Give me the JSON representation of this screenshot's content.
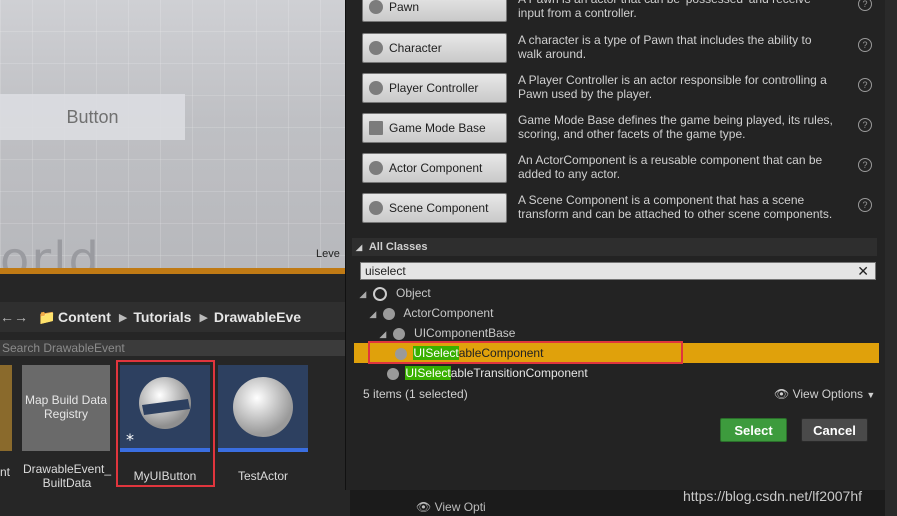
{
  "viewport": {
    "widget_text": "Button",
    "watermark_text": "orld",
    "level_label": "Leve"
  },
  "content_browser": {
    "path": [
      "Content",
      "Tutorials",
      "DrawableEve"
    ],
    "search_placeholder": "Search DrawableEvent",
    "assets": [
      {
        "label": "nt"
      },
      {
        "label": "Map Build Data Registry"
      },
      {
        "label": "DrawableEvent_ BuiltData"
      },
      {
        "label": "MyUIButton"
      },
      {
        "label": "TestActor"
      }
    ],
    "view_options": "View Opti"
  },
  "dialog": {
    "common_classes": [
      {
        "name": "Pawn",
        "icon": "pawn-icon",
        "description": "A Pawn is an actor that can be 'possessed' and receive input from a controller."
      },
      {
        "name": "Character",
        "icon": "character-icon",
        "description": "A character is a type of Pawn that includes the ability to walk around."
      },
      {
        "name": "Player Controller",
        "icon": "player-controller-icon",
        "description": "A Player Controller is an actor responsible for controlling a Pawn used by the player."
      },
      {
        "name": "Game Mode Base",
        "icon": "game-mode-icon",
        "description": "Game Mode Base defines the game being played, its rules, scoring, and other facets of the game type."
      },
      {
        "name": "Actor Component",
        "icon": "actor-component-icon",
        "description": "An ActorComponent is a reusable component that can be added to any actor."
      },
      {
        "name": "Scene Component",
        "icon": "scene-component-icon",
        "description": "A Scene Component is a component that has a scene transform and can be attached to other scene components."
      }
    ],
    "all_classes_label": "All Classes",
    "filter_value": "uiselect",
    "tree": [
      {
        "label": "Object",
        "indent": 0
      },
      {
        "label": "ActorComponent",
        "indent": 1
      },
      {
        "label": "UIComponentBase",
        "indent": 2
      },
      {
        "label_hl": "UISelect",
        "label_rest": "ableComponent",
        "indent": 3,
        "selected": true
      },
      {
        "label_hl": "UISelect",
        "label_rest": "ableTransitionComponent",
        "indent": 3
      }
    ],
    "status": "5 items (1 selected)",
    "view_options": "View Options",
    "select_label": "Select",
    "cancel_label": "Cancel"
  },
  "watermark": "https://blog.csdn.net/lf2007hf",
  "colors": {
    "select_button": "#3d9b3d",
    "selected_row": "#e0a10b",
    "search_highlight": "#39b000",
    "red_box": "#e0353d"
  }
}
